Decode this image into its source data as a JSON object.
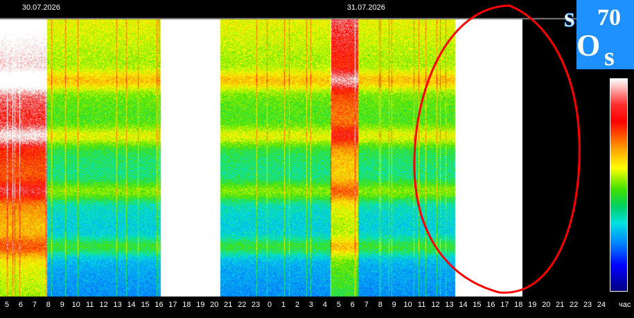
{
  "chart_data": {
    "type": "heatmap",
    "title": "",
    "date_labels": [
      "30.07.2026",
      "31.07.2026"
    ],
    "x_tick_labels": [
      "5",
      "6",
      "7",
      "8",
      "9",
      "10",
      "11",
      "12",
      "13",
      "14",
      "15",
      "16",
      "17",
      "18",
      "19",
      "20",
      "21",
      "22",
      "23",
      "0",
      "1",
      "2",
      "3",
      "4",
      "5",
      "6",
      "7",
      "8",
      "9",
      "10",
      "11",
      "12",
      "13",
      "14",
      "15",
      "16",
      "17",
      "18",
      "19",
      "20",
      "21",
      "22",
      "23",
      "24"
    ],
    "x_unit": "час",
    "x_range_hours": [
      4.5,
      48.5
    ],
    "data_end_hour": 42.3,
    "colorscale": [
      "#000080",
      "#0000ff",
      "#0080ff",
      "#00e0e0",
      "#40e000",
      "#ffff00",
      "#ff8000",
      "#ff0000",
      "#ffffff"
    ],
    "horizontal_bands_relative_height": [
      0.22,
      0.42,
      0.62,
      0.82
    ],
    "bright_events": [
      {
        "start_hour": 16.7,
        "end_hour": 20.0,
        "intensity": "saturated"
      },
      {
        "start_hour": 38.0,
        "end_hour": 42.3,
        "intensity": "saturated"
      },
      {
        "start_hour": 4.5,
        "end_hour": 7.5,
        "intensity": "high"
      },
      {
        "start_hour": 29.0,
        "end_hour": 30.0,
        "intensity": "medium"
      }
    ],
    "annotation": "red hand-drawn circle around the event starting at 14 on 31.07"
  },
  "logo": {
    "letters": [
      "s",
      "o",
      "s",
      "70"
    ],
    "bg_color": "#1e90ff"
  },
  "colors": {
    "background": "#000000",
    "text": "#ffffff",
    "annotation": "#ff0000"
  }
}
